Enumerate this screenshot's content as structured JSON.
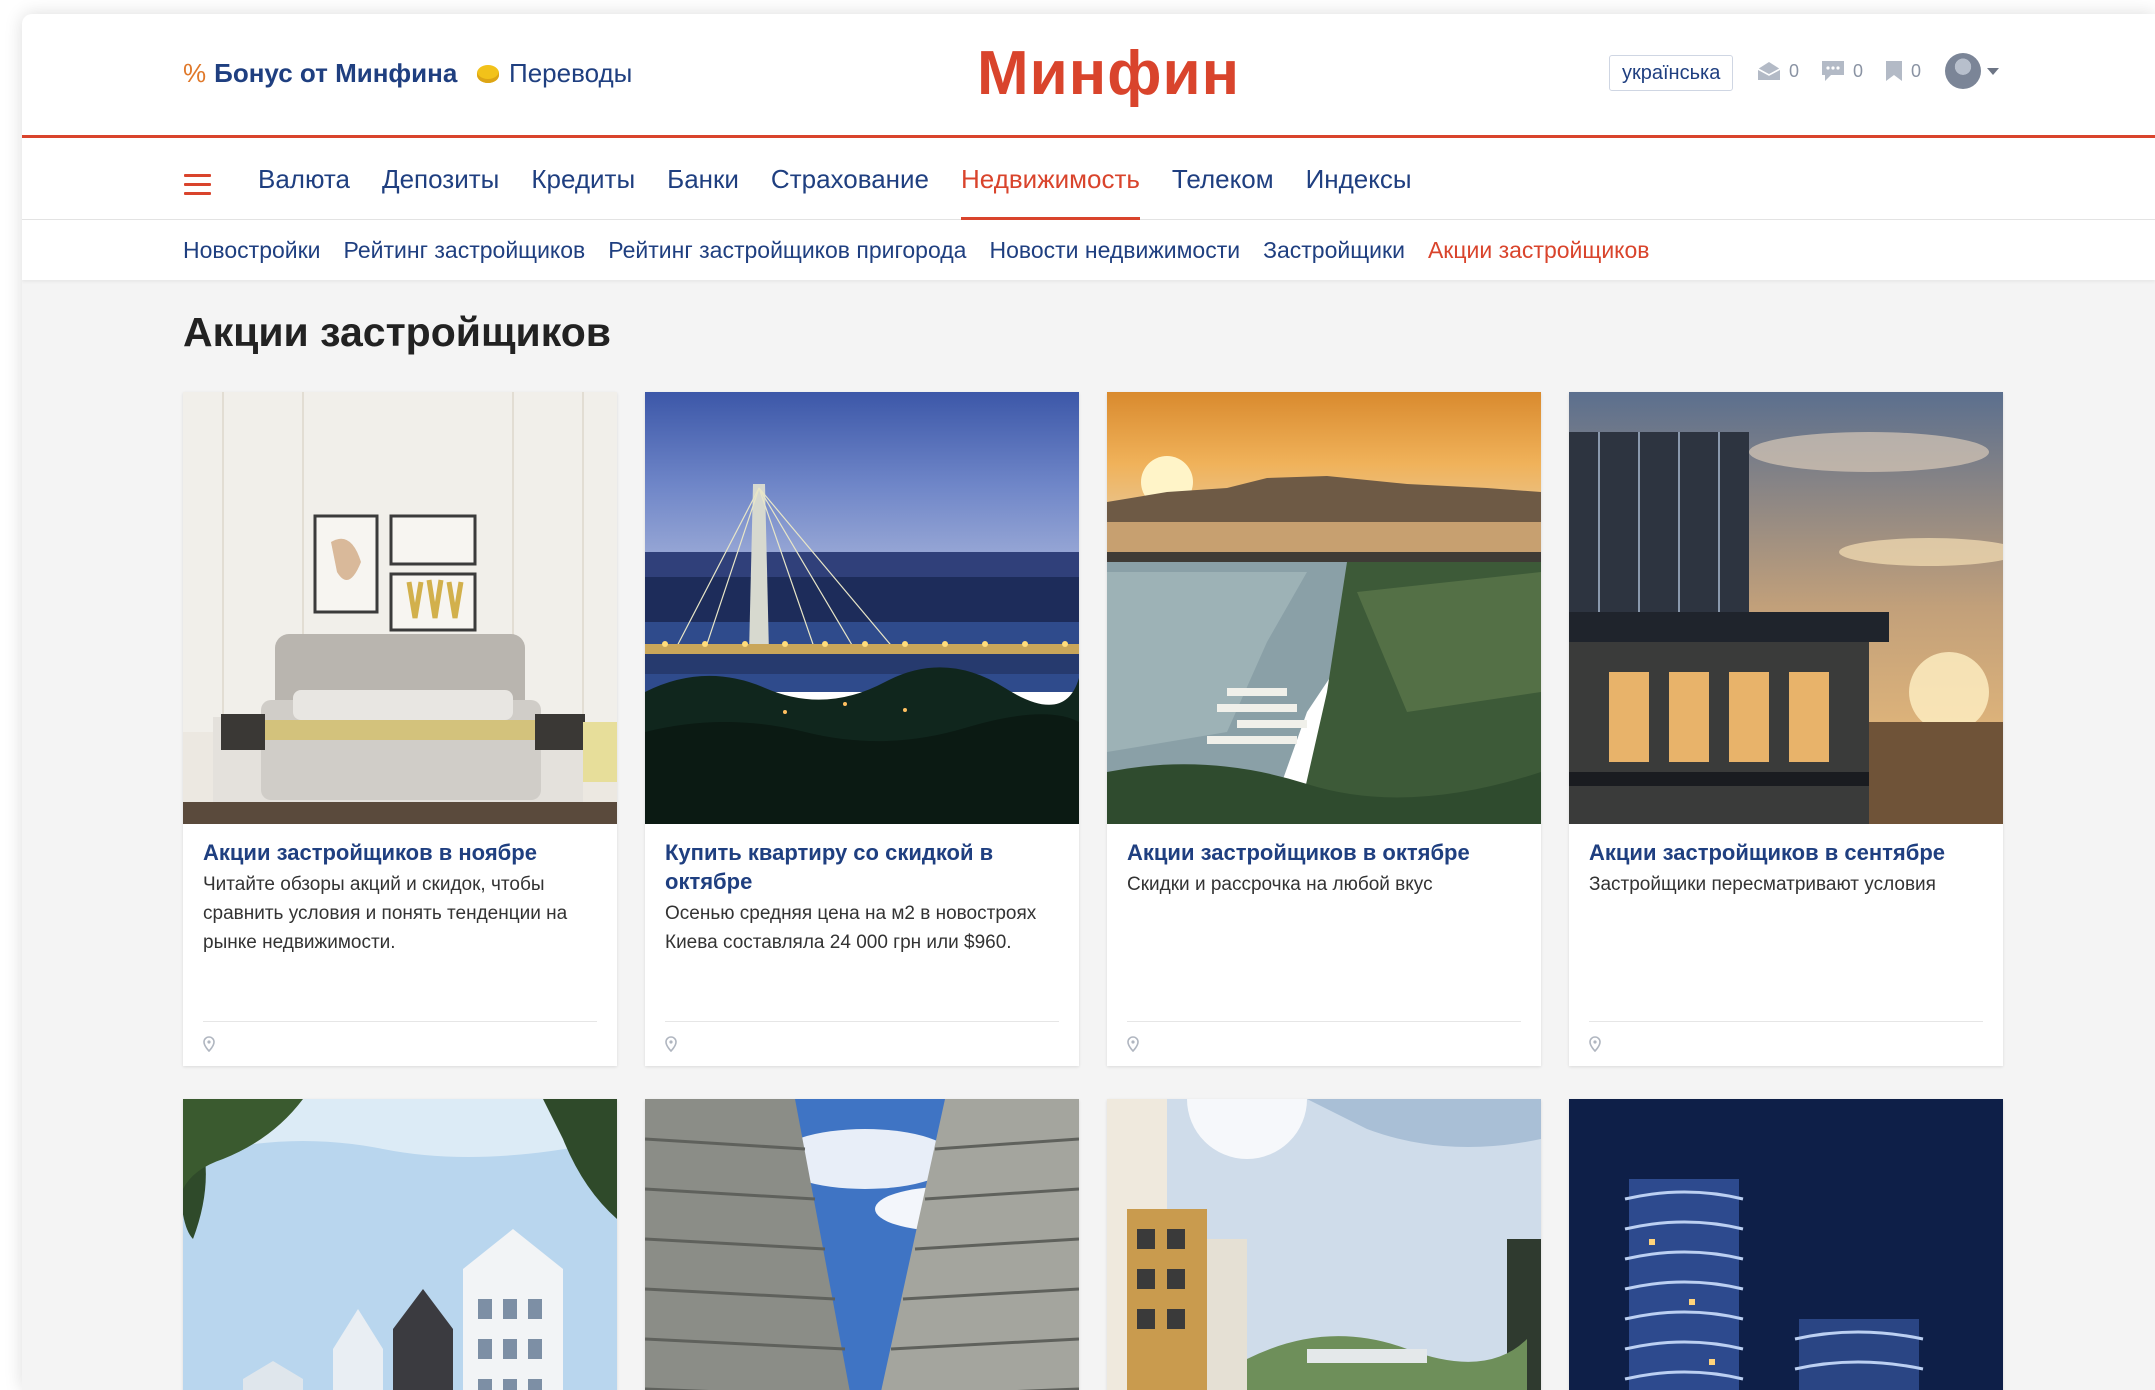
{
  "header": {
    "bonus_symbol": "%",
    "bonus_label": "Бонус от Минфина",
    "transfers_label": "Переводы",
    "logo": "Минфин",
    "language": "українська",
    "counters": [
      {
        "icon": "envelope-icon",
        "value": "0"
      },
      {
        "icon": "comments-icon",
        "value": "0"
      },
      {
        "icon": "bookmark-icon",
        "value": "0"
      }
    ]
  },
  "main_nav": {
    "items": [
      "Валюта",
      "Депозиты",
      "Кредиты",
      "Банки",
      "Страхование",
      "Недвижимость",
      "Телеком",
      "Индексы"
    ],
    "active": "Недвижимость"
  },
  "sub_nav": {
    "items": [
      "Новостройки",
      "Рейтинг застройщиков",
      "Рейтинг застройщиков пригорода",
      "Новости недвижимости",
      "Застройщики",
      "Акции застройщиков"
    ],
    "active": "Акции застройщиков"
  },
  "page": {
    "title": "Акции застройщиков"
  },
  "cards": [
    {
      "title": "Акции застройщиков в ноябре",
      "description": "Читайте обзоры акций и скидок, чтобы сравнить условия и понять тенденции на рынке недвижимости.",
      "image": "bedroom-interior"
    },
    {
      "title": "Купить квартиру со скидкой в октябре",
      "description": "Осенью средняя цена на м2 в новостроях Киева составляла 24 000 грн или $960.",
      "image": "night-bridge-city"
    },
    {
      "title": "Акции застройщиков в октябре",
      "description": "Скидки и рассрочка на любой вкус",
      "image": "sunset-river-marina"
    },
    {
      "title": "Акции застройщиков в сентябре",
      "description": "Застройщики пересматривают условия",
      "image": "glass-building-sunset"
    },
    {
      "title": "",
      "description": "",
      "image": "townhouses-trees"
    },
    {
      "title": "",
      "description": "",
      "image": "highrise-towers-sky"
    },
    {
      "title": "",
      "description": "",
      "image": "park-between-buildings"
    },
    {
      "title": "",
      "description": "",
      "image": "wavy-towers-night"
    }
  ],
  "colors": {
    "brand": "#d9442c",
    "link": "#1f3f80",
    "background": "#f4f4f4"
  }
}
